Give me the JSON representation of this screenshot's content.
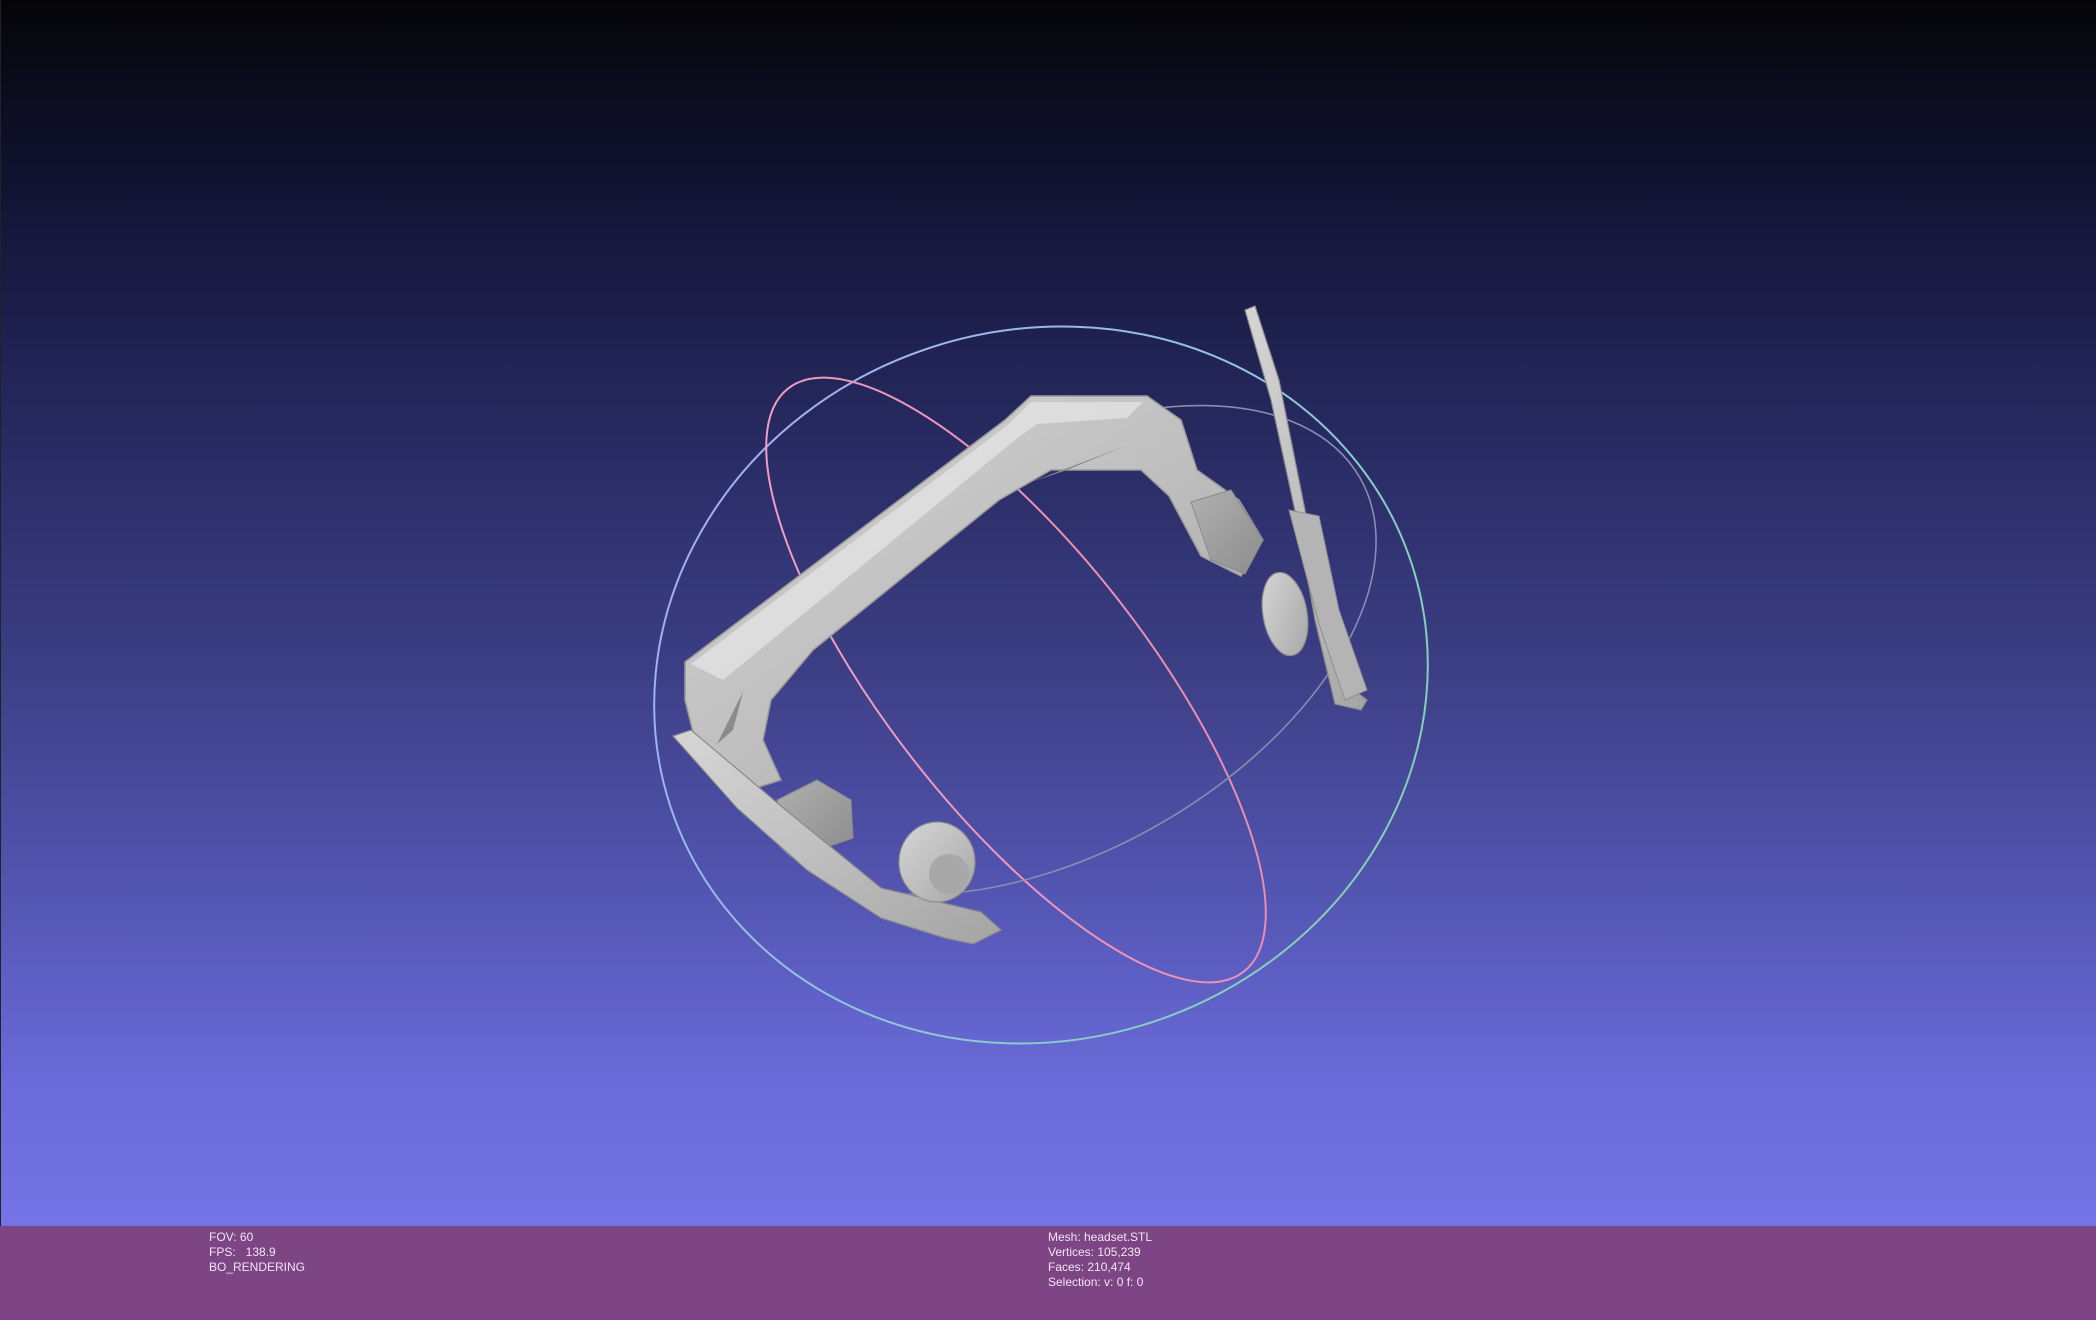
{
  "viewer": {
    "background_top": "#050508",
    "background_bottom": "#7474e6",
    "statusbar_color": "#7e4585"
  },
  "scene": {
    "model_icon": "headset-model",
    "trackball_icon": "trackball-gizmo"
  },
  "status_left": {
    "fov": "FOV: 60",
    "fps": "FPS:   138.9",
    "mode": "BO_RENDERING"
  },
  "status_right": {
    "mesh": "Mesh: headset.STL",
    "vertices": "Vertices: 105,239",
    "faces": "Faces: 210,474",
    "selection": "Selection: v: 0 f: 0"
  }
}
